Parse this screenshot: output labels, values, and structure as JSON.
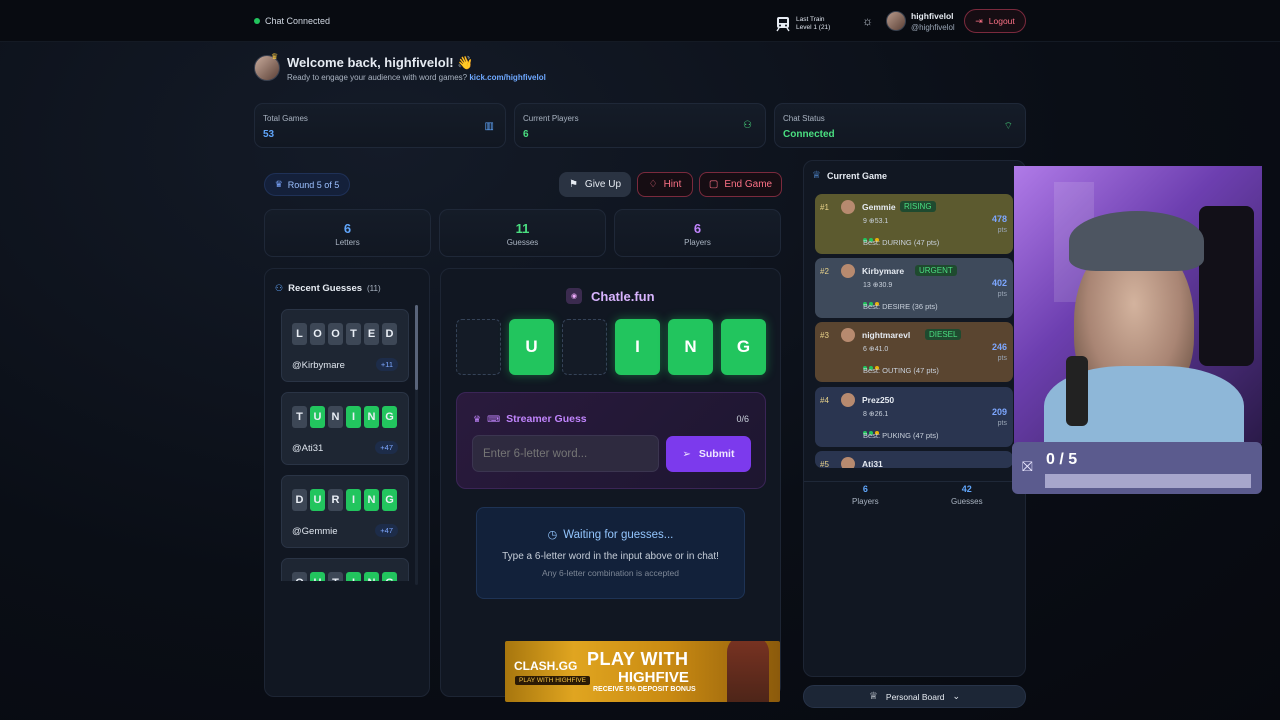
{
  "topbar": {
    "chat_status": "Chat Connected",
    "train_label": "Last Train",
    "train_level": "Level 1",
    "train_count": "(21)",
    "username": "highfivelol",
    "handle": "@highfivelol",
    "logout_label": "Logout"
  },
  "welcome": {
    "title": "Welcome back, highfivelol! 👋",
    "subtitle": "Ready to engage your audience with word games?",
    "link": "kick.com/highfivelol"
  },
  "stats": [
    {
      "label": "Total Games",
      "value": "53"
    },
    {
      "label": "Current Players",
      "value": "6"
    },
    {
      "label": "Chat Status",
      "value": "Connected"
    }
  ],
  "round": {
    "label": "Round 5 of 5"
  },
  "actions": {
    "give_up": "Give Up",
    "hint": "Hint",
    "end_game": "End Game"
  },
  "counters": [
    {
      "value": "6",
      "label": "Letters"
    },
    {
      "value": "11",
      "label": "Guesses"
    },
    {
      "value": "6",
      "label": "Players"
    }
  ],
  "recent": {
    "title": "Recent Guesses",
    "count": "(11)",
    "items": [
      {
        "letters": [
          "L",
          "O",
          "O",
          "T",
          "E",
          "D"
        ],
        "states": [
          "n",
          "n",
          "n",
          "n",
          "n",
          "n"
        ],
        "user": "@Kirbymare",
        "points": "+11"
      },
      {
        "letters": [
          "T",
          "U",
          "N",
          "I",
          "N",
          "G"
        ],
        "states": [
          "n",
          "g",
          "n",
          "g",
          "g",
          "g"
        ],
        "user": "@Ati31",
        "points": "+47"
      },
      {
        "letters": [
          "D",
          "U",
          "R",
          "I",
          "N",
          "G"
        ],
        "states": [
          "n",
          "g",
          "n",
          "g",
          "g",
          "g"
        ],
        "user": "@Gemmie",
        "points": "+47"
      },
      {
        "letters": [
          "O",
          "U",
          "T",
          "I",
          "N",
          "G"
        ],
        "states": [
          "n",
          "g",
          "n",
          "g",
          "g",
          "g"
        ],
        "user": "",
        "points": ""
      }
    ]
  },
  "board": {
    "brand": "Chatle.fun",
    "tiles": [
      "",
      "U",
      "",
      "I",
      "N",
      "G"
    ]
  },
  "streamer": {
    "title": "Streamer Guess",
    "progress": "0/6",
    "placeholder": "Enter 6-letter word...",
    "submit": "Submit"
  },
  "waiting": {
    "title": "Waiting for guesses...",
    "line1": "Type a 6-letter word in the input above or in chat!",
    "line2": "Any 6-letter combination is accepted"
  },
  "ad": {
    "brand": "CLASH.GG",
    "headline1": "PLAY WITH",
    "headline2": "HIGHFIVE",
    "subline": "RECEIVE 5% DEPOSIT BONUS",
    "tag": "PLAY WITH HIGHFIVE"
  },
  "current_game": {
    "title": "Current Game",
    "players": [
      {
        "rank": "#1",
        "name": "Gemmie",
        "tag": "RISING",
        "meta": "9 ⊕53.1",
        "best": "Best: DURING (47 pts)",
        "points": "478",
        "color": "#5c5a2f"
      },
      {
        "rank": "#2",
        "name": "Kirbymare",
        "tag": "URGENT",
        "meta": "13 ⊕30.9",
        "best": "Best: DESIRE (36 pts)",
        "points": "402",
        "color": "#3e4a5b"
      },
      {
        "rank": "#3",
        "name": "nightmarevl",
        "tag": "DIESEL",
        "meta": "6 ⊕41.0",
        "best": "Best: OUTING (47 pts)",
        "points": "246",
        "color": "#5a4530"
      },
      {
        "rank": "#4",
        "name": "Prez250",
        "tag": "",
        "meta": "8 ⊕26.1",
        "best": "Best: PUKING (47 pts)",
        "points": "209",
        "color": "#2a3550"
      },
      {
        "rank": "#5",
        "name": "Ati31",
        "tag": "",
        "meta": "",
        "best": "",
        "points": "",
        "color": "#2a3550"
      }
    ],
    "footer": [
      {
        "value": "6",
        "label": "Players"
      },
      {
        "value": "42",
        "label": "Guesses"
      }
    ],
    "personal_board": "Personal Board"
  },
  "overlay": {
    "progress": "0 / 5"
  }
}
